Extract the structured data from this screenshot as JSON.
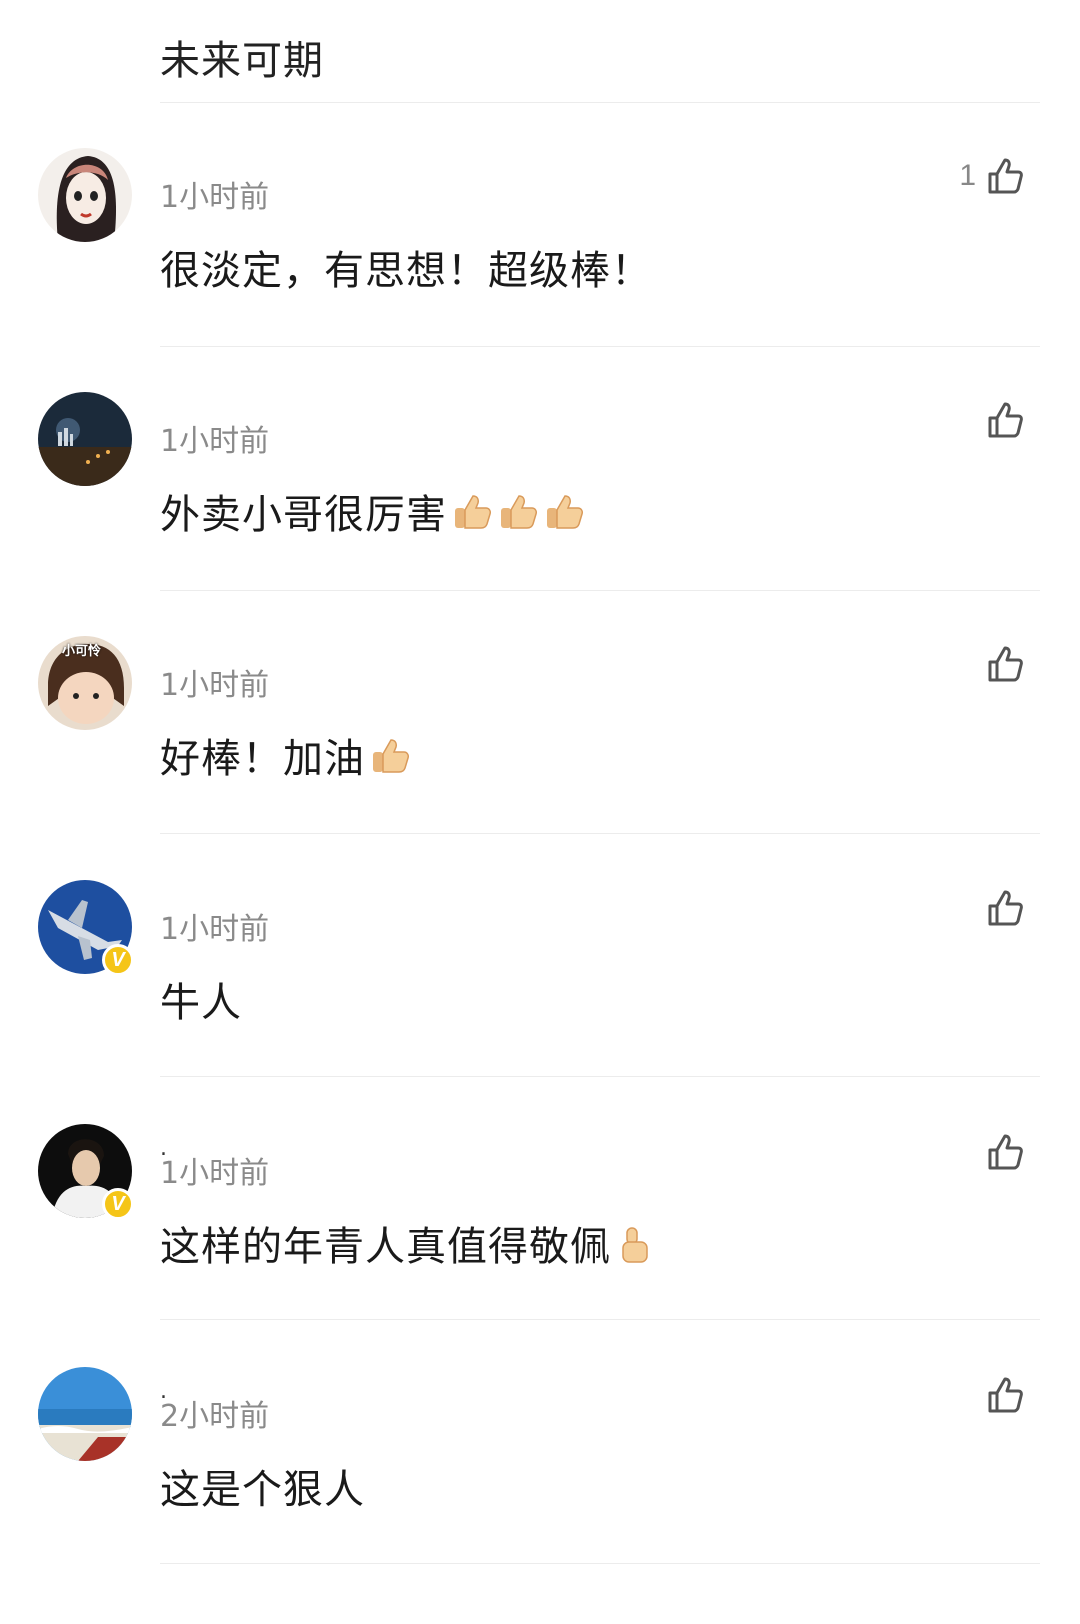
{
  "top_comment_text": "未来可期",
  "comments": [
    {
      "username": "",
      "time": "1小时前",
      "text": "很淡定，有思想！超级棒！",
      "likes": "1",
      "verified": false,
      "emoji_count": 0
    },
    {
      "username": "",
      "time": "1小时前",
      "text": "外卖小哥很厉害",
      "likes": "",
      "verified": false,
      "emoji_count": 3
    },
    {
      "username": "",
      "time": "1小时前",
      "text": "好棒！加油",
      "likes": "",
      "verified": false,
      "emoji_count": 1,
      "avatar_label": "小可怜"
    },
    {
      "username": "",
      "time": "1小时前",
      "text": "牛人",
      "likes": "",
      "verified": true,
      "emoji_count": 0
    },
    {
      "username": ".",
      "time": "1小时前",
      "text": "这样的年青人真值得敬佩",
      "likes": "",
      "verified": true,
      "emoji_count": 1
    },
    {
      "username": ".",
      "time": "2小时前",
      "text": "这是个狠人",
      "likes": "",
      "verified": false,
      "emoji_count": 0
    }
  ],
  "icons": {
    "like": "thumbs-up-outline-icon",
    "emoji": "thumbs-up-emoji-icon",
    "verified": "verified-v-badge-icon"
  },
  "colors": {
    "text": "#1a1a1a",
    "secondary": "#8a8a8a",
    "divider": "#ececec",
    "verified_badge": "#f5c518"
  }
}
